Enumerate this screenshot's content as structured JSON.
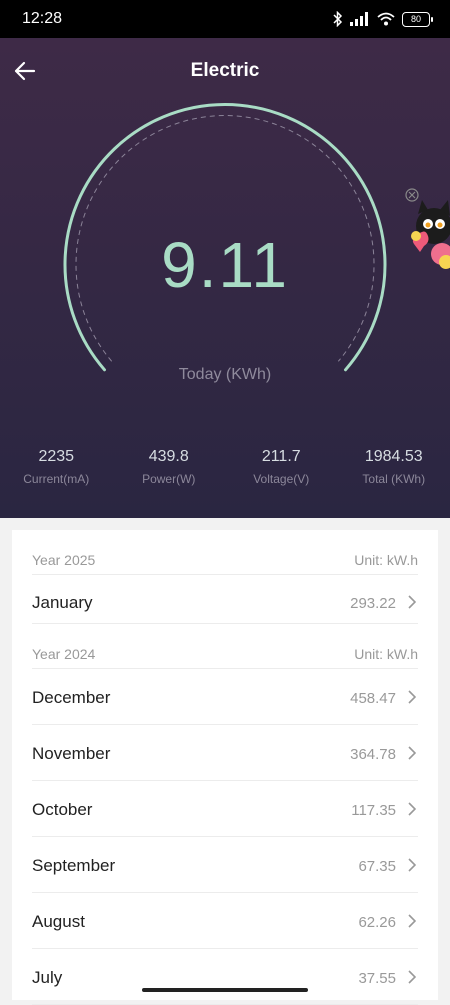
{
  "status_bar": {
    "time": "12:28",
    "battery": "80"
  },
  "header": {
    "title": "Electric"
  },
  "gauge": {
    "today_value": "9.11",
    "today_label": "Today (KWh)"
  },
  "stats": [
    {
      "value": "2235",
      "label": "Current(mA)"
    },
    {
      "value": "439.8",
      "label": "Power(W)"
    },
    {
      "value": "211.7",
      "label": "Voltage(V)"
    },
    {
      "value": "1984.53",
      "label": "Total (KWh)"
    }
  ],
  "sections": [
    {
      "year": "Year 2025",
      "unit": "Unit: kW.h",
      "months": [
        {
          "name": "January",
          "value": "293.22"
        }
      ]
    },
    {
      "year": "Year 2024",
      "unit": "Unit: kW.h",
      "months": [
        {
          "name": "December",
          "value": "458.47"
        },
        {
          "name": "November",
          "value": "364.78"
        },
        {
          "name": "October",
          "value": "117.35"
        },
        {
          "name": "September",
          "value": "67.35"
        },
        {
          "name": "August",
          "value": "62.26"
        },
        {
          "name": "July",
          "value": "37.55"
        }
      ]
    }
  ],
  "colors": {
    "accent": "#a9dcc5",
    "hero_top": "#3e2a47",
    "hero_bottom": "#2a2641"
  }
}
